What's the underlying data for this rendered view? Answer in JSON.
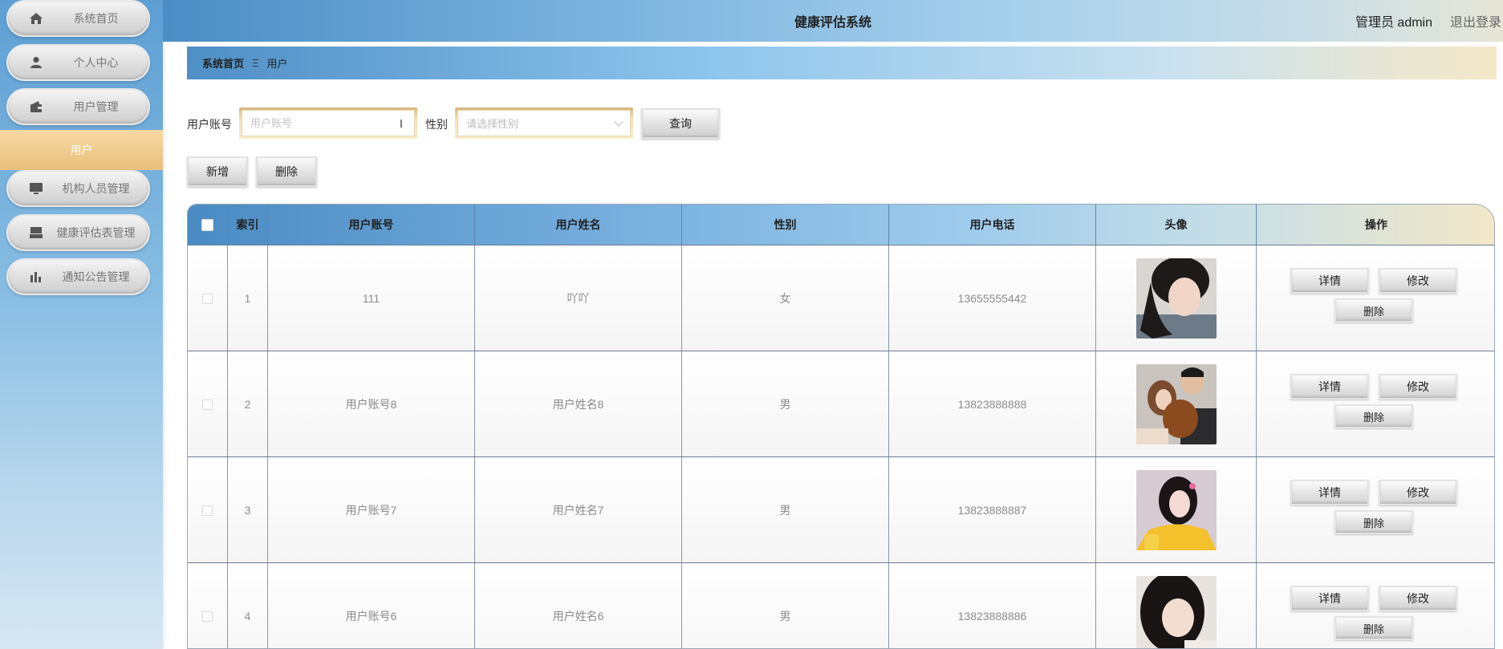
{
  "app": {
    "title": "健康评估系统",
    "user_label": "管理员 admin",
    "logout_label": "退出登录"
  },
  "sidebar": {
    "items": [
      {
        "label": "系统首页",
        "icon": "home-icon"
      },
      {
        "label": "个人中心",
        "icon": "person-icon"
      },
      {
        "label": "用户管理",
        "icon": "wallet-icon"
      },
      {
        "label": "机构人员管理",
        "icon": "monitor-icon"
      },
      {
        "label": "健康评估表管理",
        "icon": "tray-icon"
      },
      {
        "label": "通知公告管理",
        "icon": "bar-chart-icon"
      }
    ],
    "active_sub": "用户",
    "accent_color": "#e8c07d"
  },
  "breadcrumb": {
    "home": "系统首页",
    "separator": "Ξ",
    "current": "用户"
  },
  "search": {
    "account_label": "用户账号",
    "account_placeholder": "用户账号",
    "gender_label": "性别",
    "gender_placeholder": "请选择性别",
    "query_button": "查询"
  },
  "actions": {
    "add_button": "新增",
    "delete_button": "删除"
  },
  "table": {
    "columns": [
      "索引",
      "用户账号",
      "用户姓名",
      "性别",
      "用户电话",
      "头像",
      "操作"
    ],
    "rows": [
      {
        "index": "1",
        "account": "111",
        "name": "吖吖",
        "gender": "女",
        "phone": "13655555442"
      },
      {
        "index": "2",
        "account": "用户账号8",
        "name": "用户姓名8",
        "gender": "男",
        "phone": "13823888888"
      },
      {
        "index": "3",
        "account": "用户账号7",
        "name": "用户姓名7",
        "gender": "男",
        "phone": "13823888887"
      },
      {
        "index": "4",
        "account": "用户账号6",
        "name": "用户姓名6",
        "gender": "男",
        "phone": "13823888886"
      }
    ],
    "row_actions": {
      "detail": "详情",
      "edit": "修改",
      "delete": "删除"
    }
  }
}
